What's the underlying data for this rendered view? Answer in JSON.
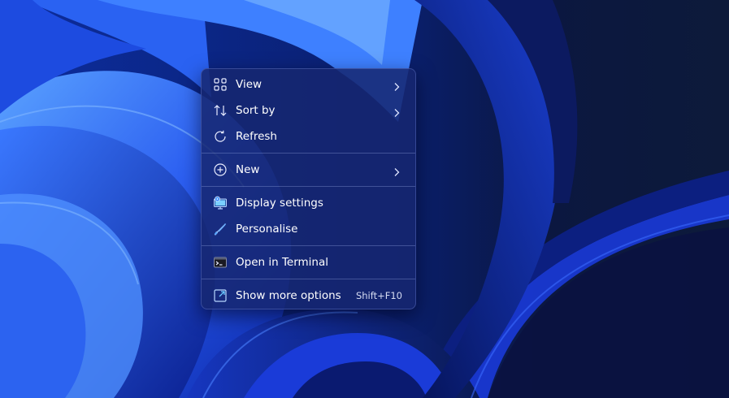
{
  "context_menu": {
    "items": [
      {
        "label": "View",
        "icon": "view-grid-icon",
        "has_submenu": true
      },
      {
        "label": "Sort by",
        "icon": "sort-icon",
        "has_submenu": true
      },
      {
        "label": "Refresh",
        "icon": "refresh-icon",
        "has_submenu": false
      },
      {
        "label": "New",
        "icon": "new-plus-icon",
        "has_submenu": true
      },
      {
        "label": "Display settings",
        "icon": "display-settings-icon",
        "has_submenu": false
      },
      {
        "label": "Personalise",
        "icon": "paintbrush-icon",
        "has_submenu": false
      },
      {
        "label": "Open in Terminal",
        "icon": "terminal-icon",
        "has_submenu": false
      },
      {
        "label": "Show more options",
        "icon": "show-more-icon",
        "shortcut": "Shift+F10",
        "has_submenu": false
      }
    ]
  },
  "colors": {
    "menu_background": "#162670",
    "text": "#ffffff",
    "icon_accent": "#60c8ff",
    "wallpaper_dark": "#0a1a4a",
    "wallpaper_bright": "#3a7cff"
  }
}
